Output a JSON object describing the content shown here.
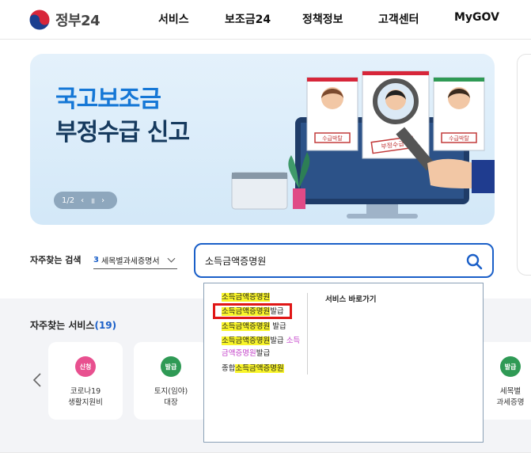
{
  "header": {
    "logo_text": "정부24",
    "nav": [
      "서비스",
      "보조금24",
      "정책정보",
      "고객센터",
      "MyGOV"
    ]
  },
  "banner": {
    "line1": "국고보조금",
    "line2": "부정수급 신고",
    "pager": {
      "current": "1/2",
      "prev": "‹",
      "pause": "॥",
      "next": "›"
    },
    "stamps": [
      "수급박탈",
      "부정수급",
      "수급박탈"
    ]
  },
  "search": {
    "faq_label": "자주찾는 검색",
    "faq_number": "3",
    "faq_selected": "세목별과세증명서",
    "query": "소득금액증명원"
  },
  "suggestions": [
    {
      "parts": [
        {
          "t": "소득금액증명원",
          "s": "hl"
        }
      ]
    },
    {
      "parts": [
        {
          "t": "소득금액증명원",
          "s": "hl"
        },
        {
          "t": "발급",
          "s": ""
        }
      ]
    },
    {
      "parts": [
        {
          "t": "소득금액증명원",
          "s": "hl"
        },
        {
          "t": " 발급",
          "s": ""
        }
      ]
    },
    {
      "parts": [
        {
          "t": "소득금액증명원",
          "s": "hl"
        },
        {
          "t": "발급 ",
          "s": ""
        },
        {
          "t": "소득",
          "s": "pk"
        }
      ]
    },
    {
      "parts": [
        {
          "t": "금액증명원",
          "s": "pk"
        },
        {
          "t": "발급",
          "s": ""
        }
      ]
    },
    {
      "parts": [
        {
          "t": "종합",
          "s": ""
        },
        {
          "t": "소득금액증명원",
          "s": "hl"
        }
      ]
    }
  ],
  "dropdown_right_title": "서비스 바로가기",
  "services": {
    "title": "자주찾는 서비스",
    "count": "(19)",
    "cards": [
      {
        "badge": "신청",
        "line1": "코로나19",
        "line2": "생활지원비",
        "color": "#e8508f"
      },
      {
        "badge": "발급",
        "line1": "토지(임야)",
        "line2": "대장",
        "color": "#2f9a55"
      },
      {
        "badge": "발급",
        "line1": "세목별",
        "line2": "과세증명",
        "color": "#2f9a55"
      }
    ]
  },
  "colors": {
    "primary": "#1a5fc8",
    "highlight": "#f8f42a",
    "red_box": "#e01616"
  }
}
